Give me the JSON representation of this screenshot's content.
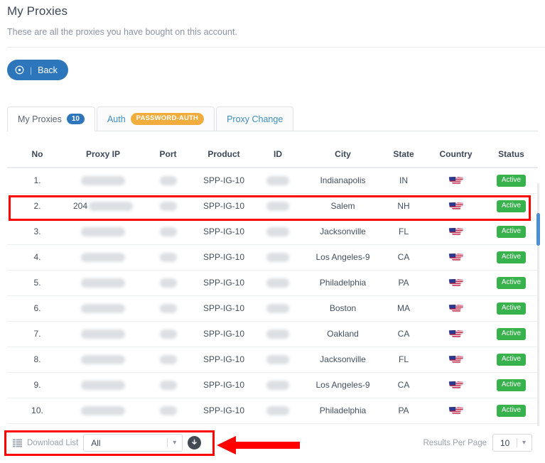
{
  "page": {
    "title": "My Proxies",
    "subtitle": "These are all the proxies you have bought on this account.",
    "back_label": "Back",
    "back_separator": "|"
  },
  "tabs": [
    {
      "label": "My Proxies",
      "badge": "10",
      "badge_type": "count",
      "active": true
    },
    {
      "label": "Auth",
      "badge": "PASSWORD-AUTH",
      "badge_type": "auth",
      "active": false
    },
    {
      "label": "Proxy Change",
      "badge": "",
      "badge_type": "none",
      "active": false
    }
  ],
  "table": {
    "columns": [
      "No",
      "Proxy IP",
      "Port",
      "Product",
      "ID",
      "City",
      "State",
      "Country",
      "Status"
    ],
    "rows": [
      {
        "no": "1.",
        "ip_prefix": "",
        "ip_redacted": true,
        "port_redacted": true,
        "product": "SPP-IG-10",
        "id_redacted": true,
        "city": "Indianapolis",
        "state": "IN",
        "country": "us-flag",
        "status": "Active"
      },
      {
        "no": "2.",
        "ip_prefix": "204",
        "ip_redacted": true,
        "port_redacted": true,
        "product": "SPP-IG-10",
        "id_redacted": true,
        "city": "Salem",
        "state": "NH",
        "country": "us-flag",
        "status": "Active"
      },
      {
        "no": "3.",
        "ip_prefix": "",
        "ip_redacted": true,
        "port_redacted": true,
        "product": "SPP-IG-10",
        "id_redacted": true,
        "city": "Jacksonville",
        "state": "FL",
        "country": "us-flag",
        "status": "Active"
      },
      {
        "no": "4.",
        "ip_prefix": "",
        "ip_redacted": true,
        "port_redacted": true,
        "product": "SPP-IG-10",
        "id_redacted": true,
        "city": "Los Angeles-9",
        "state": "CA",
        "country": "us-flag",
        "status": "Active"
      },
      {
        "no": "5.",
        "ip_prefix": "",
        "ip_redacted": true,
        "port_redacted": true,
        "product": "SPP-IG-10",
        "id_redacted": true,
        "city": "Philadelphia",
        "state": "PA",
        "country": "us-flag",
        "status": "Active"
      },
      {
        "no": "6.",
        "ip_prefix": "",
        "ip_redacted": true,
        "port_redacted": true,
        "product": "SPP-IG-10",
        "id_redacted": true,
        "city": "Boston",
        "state": "MA",
        "country": "us-flag",
        "status": "Active"
      },
      {
        "no": "7.",
        "ip_prefix": "",
        "ip_redacted": true,
        "port_redacted": true,
        "product": "SPP-IG-10",
        "id_redacted": true,
        "city": "Oakland",
        "state": "CA",
        "country": "us-flag",
        "status": "Active"
      },
      {
        "no": "8.",
        "ip_prefix": "",
        "ip_redacted": true,
        "port_redacted": true,
        "product": "SPP-IG-10",
        "id_redacted": true,
        "city": "Jacksonville",
        "state": "FL",
        "country": "us-flag",
        "status": "Active"
      },
      {
        "no": "9.",
        "ip_prefix": "",
        "ip_redacted": true,
        "port_redacted": true,
        "product": "SPP-IG-10",
        "id_redacted": true,
        "city": "Los Angeles-9",
        "state": "CA",
        "country": "us-flag",
        "status": "Active"
      },
      {
        "no": "10.",
        "ip_prefix": "",
        "ip_redacted": true,
        "port_redacted": true,
        "product": "SPP-IG-10",
        "id_redacted": true,
        "city": "Philadelphia",
        "state": "PA",
        "country": "us-flag",
        "status": "Active"
      }
    ]
  },
  "footer": {
    "download_label": "Download List",
    "download_value": "All",
    "results_label": "Results Per Page",
    "results_value": "10"
  },
  "colors": {
    "primary_blue": "#2e76bc",
    "tab_link": "#3c8dbc",
    "badge_auth_orange": "#f0ad3e",
    "status_green": "#37b24d",
    "annotation_red": "#ff0000",
    "scrollbar_thumb": "#4a8fd4"
  },
  "annotations": {
    "highlight_row_index": 1,
    "highlight_download_area": true,
    "arrow_direction": "left"
  }
}
